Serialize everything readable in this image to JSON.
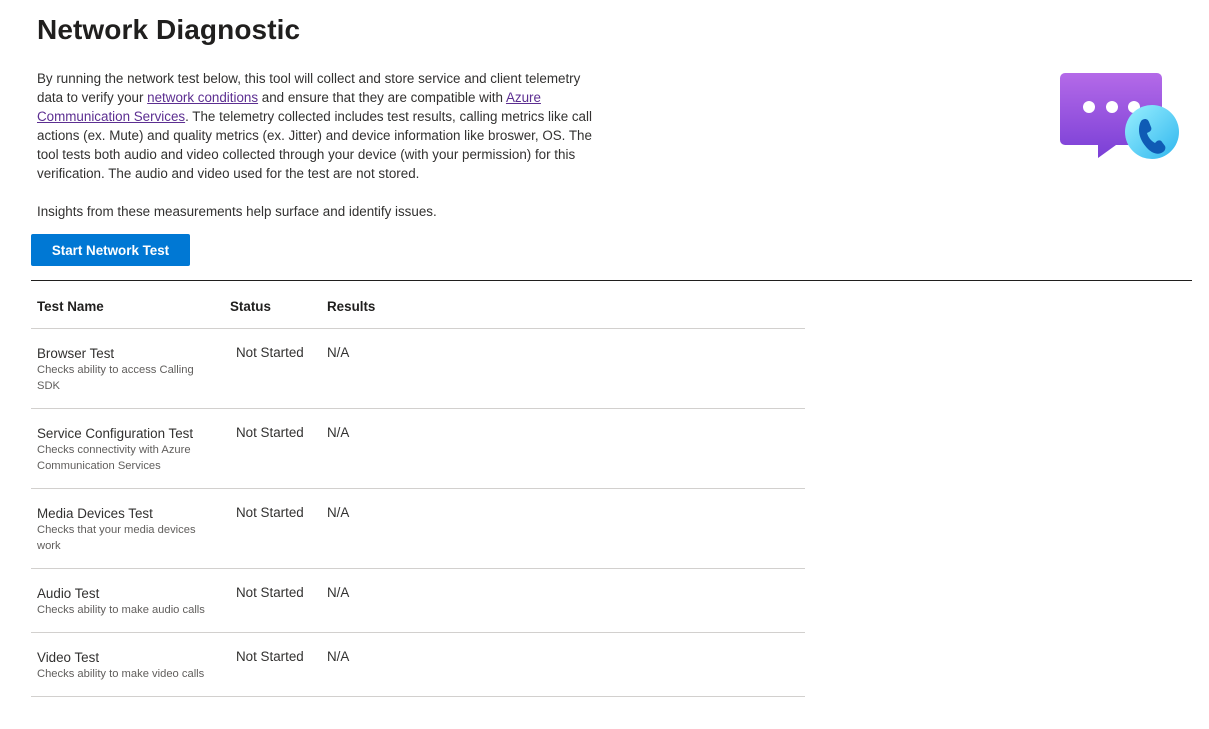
{
  "header": {
    "title": "Network Diagnostic"
  },
  "intro": {
    "part1": "By running the network test below, this tool will collect and store service and client telemetry data to verify your ",
    "link1": "network conditions",
    "part2": " and ensure that they are compatible with ",
    "link2": "Azure Communication Services",
    "part3": ". The telemetry collected includes test results, calling metrics like call actions (ex. Mute) and quality metrics (ex. Jitter) and device information like broswer, OS. The tool tests both audio and video collected through your device (with your permission) for this verification. The audio and video used for the test are not stored."
  },
  "insights": "Insights from these measurements help surface and identify issues.",
  "start_button": "Start Network Test",
  "hero_icon": "chat-call-icon",
  "colors": {
    "accent": "#0078d4",
    "link": "#5c2e91",
    "icon_purple": "#8a4ee6",
    "icon_cyan": "#4cc8f4"
  },
  "table": {
    "headers": {
      "name": "Test Name",
      "status": "Status",
      "results": "Results"
    },
    "rows": [
      {
        "name": "Browser Test",
        "desc": "Checks ability to access Calling SDK",
        "status": "Not Started",
        "results": "N/A"
      },
      {
        "name": "Service Configuration Test",
        "desc": "Checks connectivity with Azure Communication Services",
        "status": "Not Started",
        "results": "N/A"
      },
      {
        "name": "Media Devices Test",
        "desc": "Checks that your media devices work",
        "status": "Not Started",
        "results": "N/A"
      },
      {
        "name": "Audio Test",
        "desc": "Checks ability to make audio calls",
        "status": "Not Started",
        "results": "N/A"
      },
      {
        "name": "Video Test",
        "desc": "Checks ability to make video calls",
        "status": "Not Started",
        "results": "N/A"
      }
    ]
  }
}
